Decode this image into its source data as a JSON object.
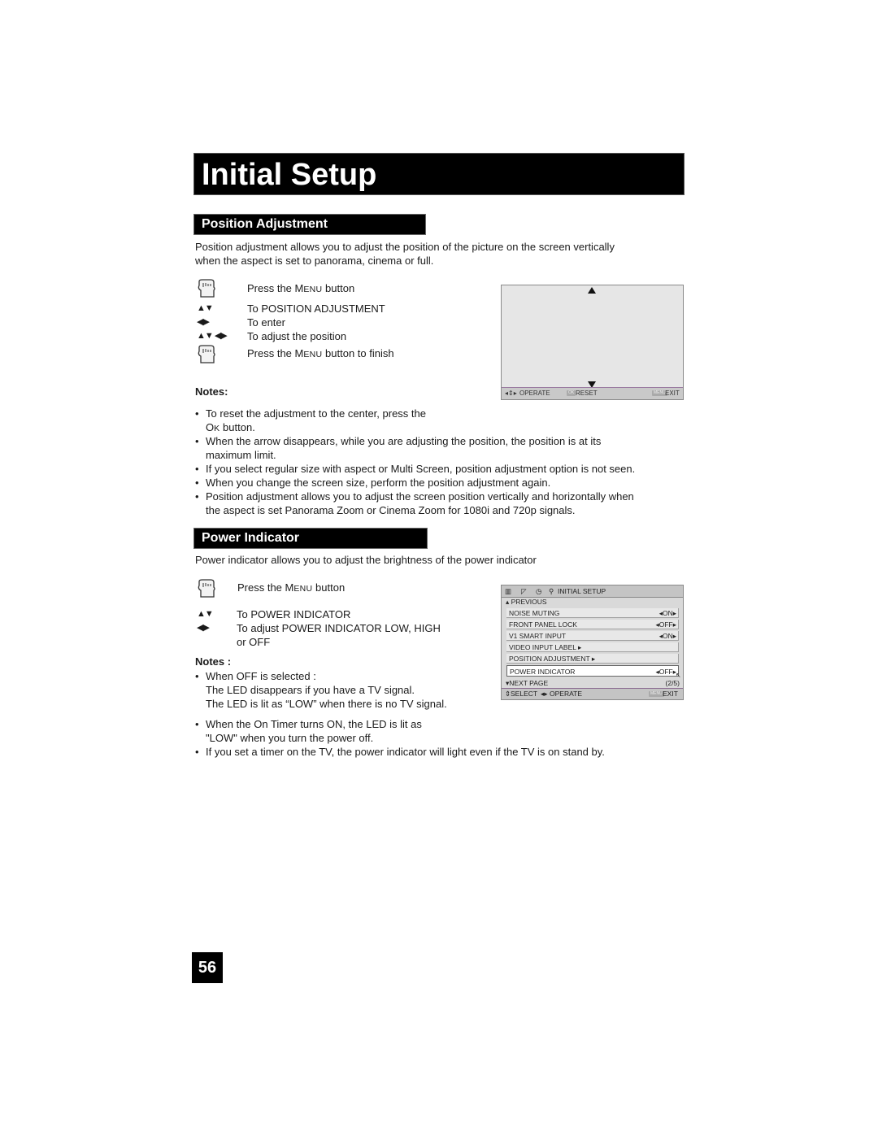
{
  "page_title": "Initial Setup",
  "page_number": "56",
  "position_adjustment": {
    "heading": "Position Adjustment",
    "intro_line1": "Position adjustment allows you to adjust the position of the picture on the screen vertically",
    "intro_line2": "when the aspect is set to panorama, cinema or full.",
    "steps": [
      {
        "icon": "hand-button-icon",
        "pre": "Press the M",
        "sc": "ENU",
        "post": " button"
      },
      {
        "icon": "up-down-arrows-icon",
        "arrows": "▲▼",
        "text": "To POSITION ADJUSTMENT"
      },
      {
        "icon": "left-right-arrows-icon",
        "arrows": "◀▶",
        "text": "To enter"
      },
      {
        "icon": "all-arrows-icon",
        "arrows": "▲▼ ◀▶",
        "text": "To adjust the position"
      },
      {
        "icon": "hand-button-icon",
        "pre": "Press the M",
        "sc": "ENU",
        "post": " button to finish"
      }
    ],
    "notes_heading": "Notes:",
    "notes": [
      {
        "line1": "To reset the adjustment to the center, press the",
        "line2_pre": "O",
        "line2_sc": "K",
        "line2_post": " button."
      },
      {
        "line1": "When the arrow disappears, while you are adjusting the position, the position is at its",
        "line2": "maximum limit."
      },
      {
        "line1": "If you select regular size with aspect or Multi Screen, position adjustment option is not seen."
      },
      {
        "line1": "When you change the screen size, perform the position adjustment again."
      },
      {
        "line1": "Position adjustment allows you to adjust the screen position vertically and horizontally when",
        "line2": "the aspect is set Panorama Zoom or Cinema Zoom for 1080i and 720p signals."
      }
    ],
    "screen": {
      "footer_operate": "OPERATE",
      "footer_reset_btn": "OK",
      "footer_reset": "RESET",
      "footer_exit_btn": "MENU",
      "footer_exit": "EXIT"
    }
  },
  "power_indicator": {
    "heading": "Power Indicator",
    "intro": "Power indicator allows you to adjust the brightness of the power indicator",
    "steps": [
      {
        "icon": "hand-button-icon",
        "pre": "Press the M",
        "sc": "ENU",
        "post": " button"
      },
      {
        "icon": "up-down-arrows-icon",
        "arrows": "▲▼",
        "text": "To POWER INDICATOR"
      },
      {
        "icon": "left-right-arrows-icon",
        "arrows": "◀▶",
        "text": "To adjust POWER INDICATOR LOW, HIGH",
        "text2": "or OFF"
      }
    ],
    "notes_heading": "Notes :",
    "notes": [
      {
        "line1": "When OFF is selected :",
        "line2": "The LED disappears if you have a TV signal.",
        "line3": "The LED is lit as “LOW” when there is no TV signal."
      },
      {
        "line1": "When the On Timer turns ON, the LED is lit as",
        "line2": "\"LOW\" when you turn the power off."
      },
      {
        "line1": "If you set a timer on the TV, the power indicator will light even if the TV is on stand by."
      }
    ],
    "menu": {
      "header_title": "INITIAL SETUP",
      "previous": "PREVIOUS",
      "items": [
        {
          "label": "NOISE MUTING",
          "value": "ON"
        },
        {
          "label": "FRONT PANEL LOCK",
          "value": "OFF"
        },
        {
          "label": "V1 SMART INPUT",
          "value": "ON"
        },
        {
          "label": "VIDEO INPUT LABEL",
          "value": ""
        },
        {
          "label": "POSITION ADJUSTMENT",
          "value": ""
        },
        {
          "label": "POWER INDICATOR",
          "value": "OFF"
        }
      ],
      "selected_index": 5,
      "next_page": "NEXT PAGE",
      "page_indicator": "(2/5)",
      "footer_select": "SELECT",
      "footer_operate": "OPERATE",
      "footer_exit_btn": "MENU",
      "footer_exit": "EXIT"
    }
  }
}
